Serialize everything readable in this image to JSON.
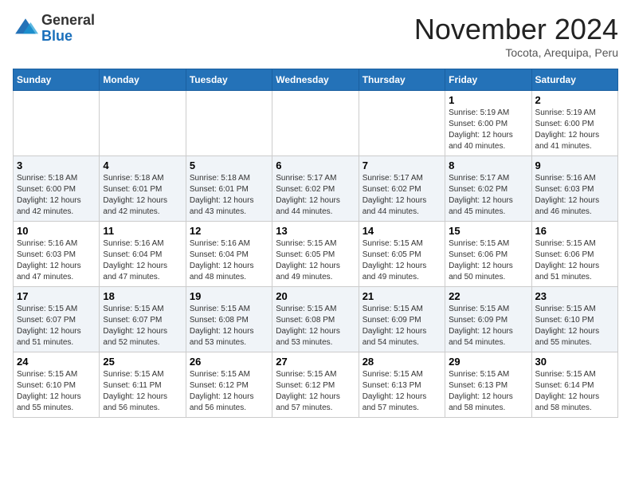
{
  "header": {
    "logo_general": "General",
    "logo_blue": "Blue",
    "month_title": "November 2024",
    "location": "Tocota, Arequipa, Peru"
  },
  "days_of_week": [
    "Sunday",
    "Monday",
    "Tuesday",
    "Wednesday",
    "Thursday",
    "Friday",
    "Saturday"
  ],
  "weeks": [
    [
      {
        "day": "",
        "info": ""
      },
      {
        "day": "",
        "info": ""
      },
      {
        "day": "",
        "info": ""
      },
      {
        "day": "",
        "info": ""
      },
      {
        "day": "",
        "info": ""
      },
      {
        "day": "1",
        "info": "Sunrise: 5:19 AM\nSunset: 6:00 PM\nDaylight: 12 hours and 40 minutes."
      },
      {
        "day": "2",
        "info": "Sunrise: 5:19 AM\nSunset: 6:00 PM\nDaylight: 12 hours and 41 minutes."
      }
    ],
    [
      {
        "day": "3",
        "info": "Sunrise: 5:18 AM\nSunset: 6:00 PM\nDaylight: 12 hours and 42 minutes."
      },
      {
        "day": "4",
        "info": "Sunrise: 5:18 AM\nSunset: 6:01 PM\nDaylight: 12 hours and 42 minutes."
      },
      {
        "day": "5",
        "info": "Sunrise: 5:18 AM\nSunset: 6:01 PM\nDaylight: 12 hours and 43 minutes."
      },
      {
        "day": "6",
        "info": "Sunrise: 5:17 AM\nSunset: 6:02 PM\nDaylight: 12 hours and 44 minutes."
      },
      {
        "day": "7",
        "info": "Sunrise: 5:17 AM\nSunset: 6:02 PM\nDaylight: 12 hours and 44 minutes."
      },
      {
        "day": "8",
        "info": "Sunrise: 5:17 AM\nSunset: 6:02 PM\nDaylight: 12 hours and 45 minutes."
      },
      {
        "day": "9",
        "info": "Sunrise: 5:16 AM\nSunset: 6:03 PM\nDaylight: 12 hours and 46 minutes."
      }
    ],
    [
      {
        "day": "10",
        "info": "Sunrise: 5:16 AM\nSunset: 6:03 PM\nDaylight: 12 hours and 47 minutes."
      },
      {
        "day": "11",
        "info": "Sunrise: 5:16 AM\nSunset: 6:04 PM\nDaylight: 12 hours and 47 minutes."
      },
      {
        "day": "12",
        "info": "Sunrise: 5:16 AM\nSunset: 6:04 PM\nDaylight: 12 hours and 48 minutes."
      },
      {
        "day": "13",
        "info": "Sunrise: 5:15 AM\nSunset: 6:05 PM\nDaylight: 12 hours and 49 minutes."
      },
      {
        "day": "14",
        "info": "Sunrise: 5:15 AM\nSunset: 6:05 PM\nDaylight: 12 hours and 49 minutes."
      },
      {
        "day": "15",
        "info": "Sunrise: 5:15 AM\nSunset: 6:06 PM\nDaylight: 12 hours and 50 minutes."
      },
      {
        "day": "16",
        "info": "Sunrise: 5:15 AM\nSunset: 6:06 PM\nDaylight: 12 hours and 51 minutes."
      }
    ],
    [
      {
        "day": "17",
        "info": "Sunrise: 5:15 AM\nSunset: 6:07 PM\nDaylight: 12 hours and 51 minutes."
      },
      {
        "day": "18",
        "info": "Sunrise: 5:15 AM\nSunset: 6:07 PM\nDaylight: 12 hours and 52 minutes."
      },
      {
        "day": "19",
        "info": "Sunrise: 5:15 AM\nSunset: 6:08 PM\nDaylight: 12 hours and 53 minutes."
      },
      {
        "day": "20",
        "info": "Sunrise: 5:15 AM\nSunset: 6:08 PM\nDaylight: 12 hours and 53 minutes."
      },
      {
        "day": "21",
        "info": "Sunrise: 5:15 AM\nSunset: 6:09 PM\nDaylight: 12 hours and 54 minutes."
      },
      {
        "day": "22",
        "info": "Sunrise: 5:15 AM\nSunset: 6:09 PM\nDaylight: 12 hours and 54 minutes."
      },
      {
        "day": "23",
        "info": "Sunrise: 5:15 AM\nSunset: 6:10 PM\nDaylight: 12 hours and 55 minutes."
      }
    ],
    [
      {
        "day": "24",
        "info": "Sunrise: 5:15 AM\nSunset: 6:10 PM\nDaylight: 12 hours and 55 minutes."
      },
      {
        "day": "25",
        "info": "Sunrise: 5:15 AM\nSunset: 6:11 PM\nDaylight: 12 hours and 56 minutes."
      },
      {
        "day": "26",
        "info": "Sunrise: 5:15 AM\nSunset: 6:12 PM\nDaylight: 12 hours and 56 minutes."
      },
      {
        "day": "27",
        "info": "Sunrise: 5:15 AM\nSunset: 6:12 PM\nDaylight: 12 hours and 57 minutes."
      },
      {
        "day": "28",
        "info": "Sunrise: 5:15 AM\nSunset: 6:13 PM\nDaylight: 12 hours and 57 minutes."
      },
      {
        "day": "29",
        "info": "Sunrise: 5:15 AM\nSunset: 6:13 PM\nDaylight: 12 hours and 58 minutes."
      },
      {
        "day": "30",
        "info": "Sunrise: 5:15 AM\nSunset: 6:14 PM\nDaylight: 12 hours and 58 minutes."
      }
    ]
  ]
}
